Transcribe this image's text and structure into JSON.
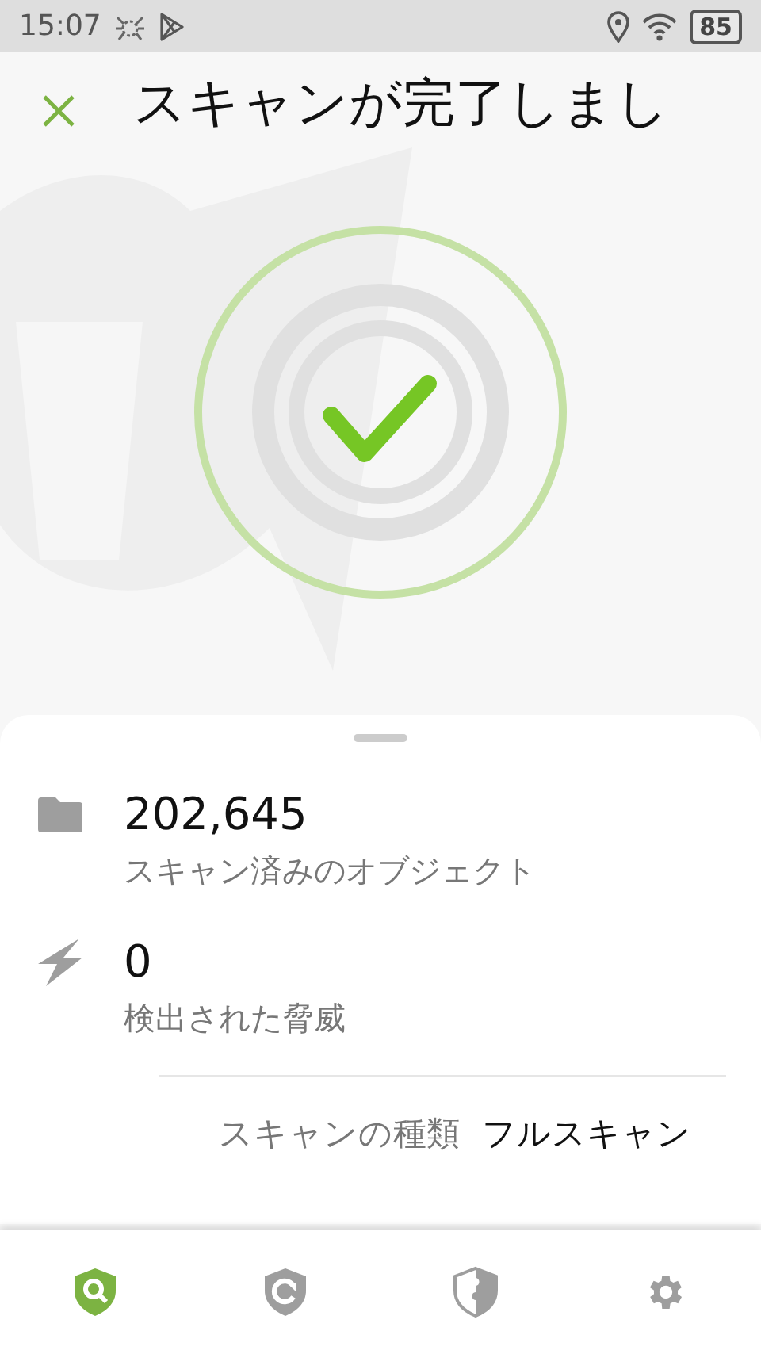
{
  "status_bar": {
    "time": "15:07",
    "battery": "85"
  },
  "header": {
    "title": "スキャンが完了しまし"
  },
  "result": {
    "stats": [
      {
        "value": "202,645",
        "label": "スキャン済みのオブジェクト"
      },
      {
        "value": "0",
        "label": "検出された脅威"
      }
    ],
    "scan_type": {
      "label": "スキャンの種類",
      "value": "フルスキャン"
    }
  },
  "bottom_nav": [
    {
      "selected": true
    },
    {
      "selected": false
    },
    {
      "selected": false
    },
    {
      "selected": false
    }
  ]
}
